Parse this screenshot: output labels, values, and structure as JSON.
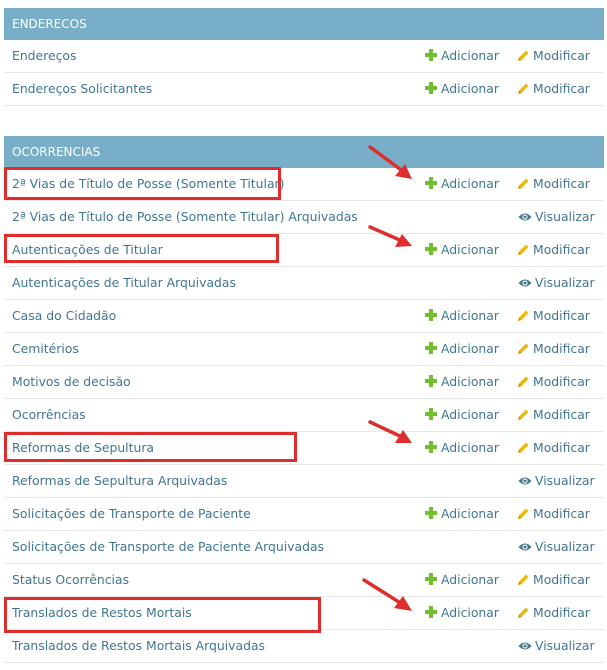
{
  "modules": [
    {
      "header": "ENDERECOS",
      "rows": [
        {
          "label": "Endereços",
          "add": "Adicionar",
          "change": "Modificar"
        },
        {
          "label": "Endereços Solicitantes",
          "add": "Adicionar",
          "change": "Modificar"
        }
      ]
    },
    {
      "header": "OCORRENCIAS",
      "rows": [
        {
          "label": "2ª Vias de Título de Posse (Somente Titular)",
          "add": "Adicionar",
          "change": "Modificar"
        },
        {
          "label": "2ª Vias de Título de Posse (Somente Titular) Arquivadas",
          "view": "Visualizar"
        },
        {
          "label": "Autenticações de Titular",
          "add": "Adicionar",
          "change": "Modificar"
        },
        {
          "label": "Autenticações de Titular Arquivadas",
          "view": "Visualizar"
        },
        {
          "label": "Casa do Cidadão",
          "add": "Adicionar",
          "change": "Modificar"
        },
        {
          "label": "Cemitérios",
          "add": "Adicionar",
          "change": "Modificar"
        },
        {
          "label": "Motivos de decisão",
          "add": "Adicionar",
          "change": "Modificar"
        },
        {
          "label": "Ocorrências",
          "add": "Adicionar",
          "change": "Modificar"
        },
        {
          "label": "Reformas de Sepultura",
          "add": "Adicionar",
          "change": "Modificar"
        },
        {
          "label": "Reformas de Sepultura Arquivadas",
          "view": "Visualizar"
        },
        {
          "label": "Solicitações de Transporte de Paciente",
          "add": "Adicionar",
          "change": "Modificar"
        },
        {
          "label": "Solicitações de Transporte de Paciente Arquivadas",
          "view": "Visualizar"
        },
        {
          "label": "Status Ocorrências",
          "add": "Adicionar",
          "change": "Modificar"
        },
        {
          "label": "Translados de Restos Mortais",
          "add": "Adicionar",
          "change": "Modificar"
        },
        {
          "label": "Translados de Restos Mortais Arquivadas",
          "view": "Visualizar"
        }
      ]
    }
  ],
  "colors": {
    "header_bg": "#79aec8",
    "link": "#417690",
    "add_icon": "#70bf2b",
    "change_icon": "#efb80b",
    "annotation": "#dd2d2d"
  }
}
